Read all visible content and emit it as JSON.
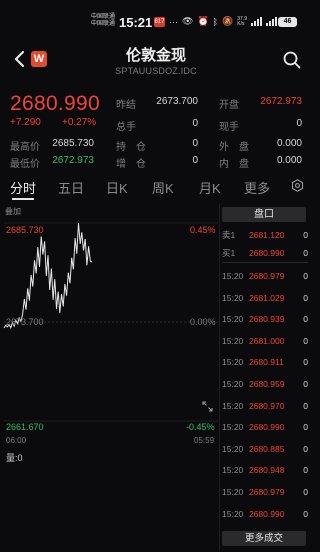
{
  "status_bar": {
    "carrier_1": "中国联通",
    "carrier_2": "中国联通",
    "time": "15:21",
    "badge": "617",
    "net_speed": "37.9",
    "net_unit": "K/s",
    "battery": "46"
  },
  "header": {
    "title": "伦敦金现",
    "subtitle": "SPTAUUSDOZ.IDC",
    "logo_letter": "W"
  },
  "quote": {
    "price": "2680.990",
    "change": "+7.290",
    "change_pct": "+0.27%",
    "fields": {
      "prev_close_label": "昨结",
      "prev_close": "2673.700",
      "open_label": "开盘",
      "open": "2672.973",
      "total_hand_label": "总手",
      "total_hand": "0",
      "now_hand_label": "现手",
      "now_hand": "0",
      "high_label": "最高价",
      "high": "2685.730",
      "position_label": "持　仓",
      "position": "0",
      "outer_label": "外　盘",
      "outer": "0.000",
      "low_label": "最低价",
      "low": "2672.973",
      "increase_label": "增　仓",
      "increase": "0",
      "inner_label": "内　盘",
      "inner": "0.000"
    }
  },
  "tabs": [
    "分时",
    "五日",
    "日K",
    "周K",
    "月K",
    "更多"
  ],
  "active_tab": 0,
  "chart": {
    "corner_label": "叠加",
    "y_top": "2685.730",
    "y_mid": "2673.700",
    "y_bottom": "2661.670",
    "pct_top": "0.45%",
    "pct_mid": "0.00%",
    "pct_bottom": "-0.45%",
    "x_start": "06:00",
    "x_end": "05:59",
    "volume_label": "量:0"
  },
  "chart_data": {
    "type": "line",
    "x_range": [
      "06:00",
      "05:59"
    ],
    "ylim": [
      2661.67,
      2685.73
    ],
    "y_ref": 2673.7,
    "series": [
      {
        "values": [
          2672.97,
          2673.3,
          2673.1,
          2673.4,
          2673.0,
          2673.6,
          2673.2,
          2673.9,
          2673.5,
          2674.2,
          2673.8,
          2674.6,
          2676.5,
          2675.2,
          2677.8,
          2676.3,
          2679.4,
          2678.0,
          2681.2,
          2679.6,
          2682.8,
          2680.4,
          2684.1,
          2681.9,
          2683.5,
          2679.3,
          2681.8,
          2677.6,
          2680.2,
          2676.4,
          2678.9,
          2675.3,
          2677.4,
          2674.8,
          2677.1,
          2675.6,
          2678.3,
          2676.9,
          2679.7,
          2678.4,
          2681.5,
          2680.1,
          2683.9,
          2682.0,
          2685.73,
          2683.2,
          2684.6,
          2682.4,
          2683.8,
          2680.6,
          2682.9,
          2681.1,
          2680.99
        ]
      }
    ]
  },
  "order_book": {
    "title": "盘口",
    "ask_label": "卖1",
    "ask_price": "2681.120",
    "ask_vol": "0",
    "bid_label": "买1",
    "bid_price": "2680.990",
    "bid_vol": "0"
  },
  "trades": [
    {
      "time": "15:20",
      "price": "2680.979",
      "vol": "0"
    },
    {
      "time": "15:20",
      "price": "2681.029",
      "vol": "0"
    },
    {
      "time": "15:20",
      "price": "2680.939",
      "vol": "0"
    },
    {
      "time": "15:20",
      "price": "2681.000",
      "vol": "0"
    },
    {
      "time": "15:20",
      "price": "2680.911",
      "vol": "0"
    },
    {
      "time": "15:20",
      "price": "2680.959",
      "vol": "0"
    },
    {
      "time": "15:20",
      "price": "2680.970",
      "vol": "0"
    },
    {
      "time": "15:20",
      "price": "2680.990",
      "vol": "0"
    },
    {
      "time": "15:20",
      "price": "2680.885",
      "vol": "0"
    },
    {
      "time": "15:20",
      "price": "2680.948",
      "vol": "0"
    },
    {
      "time": "15:20",
      "price": "2680.979",
      "vol": "0"
    },
    {
      "time": "15:20",
      "price": "2680.990",
      "vol": "0"
    }
  ],
  "more_trades_label": "更多成交",
  "colors": {
    "up": "#f0433a",
    "down": "#2fbf71",
    "line": "#e8e8e8"
  }
}
